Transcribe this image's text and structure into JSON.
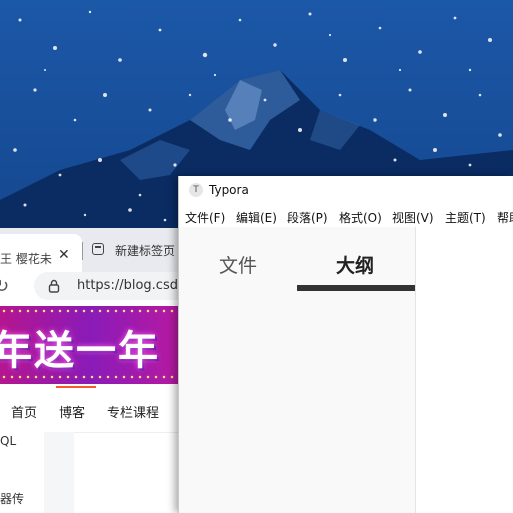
{
  "browser": {
    "tabs": [
      {
        "title": "王 樱花未",
        "close_glyph": "✕",
        "active": true
      },
      {
        "title": "新建标签页",
        "active": false
      }
    ],
    "reload_glyph": "↻",
    "url": "https://blog.csdn",
    "banner_text": "年送一年",
    "nav_items": [
      "首页",
      "博客",
      "专栏课程"
    ],
    "sidebar_snippets": [
      "QL",
      "器传"
    ],
    "accent_color": "#fc5531"
  },
  "typora": {
    "app_icon_letter": "T",
    "title": "Typora",
    "menu": [
      "文件(F)",
      "编辑(E)",
      "段落(P)",
      "格式(O)",
      "视图(V)",
      "主题(T)",
      "帮助"
    ],
    "sidebar_tabs": [
      {
        "label": "文件",
        "active": false
      },
      {
        "label": "大纲",
        "active": true
      }
    ]
  },
  "icons": [
    "reload-icon",
    "lock-icon",
    "new-tab-icon",
    "close-icon",
    "typora-app-icon"
  ]
}
